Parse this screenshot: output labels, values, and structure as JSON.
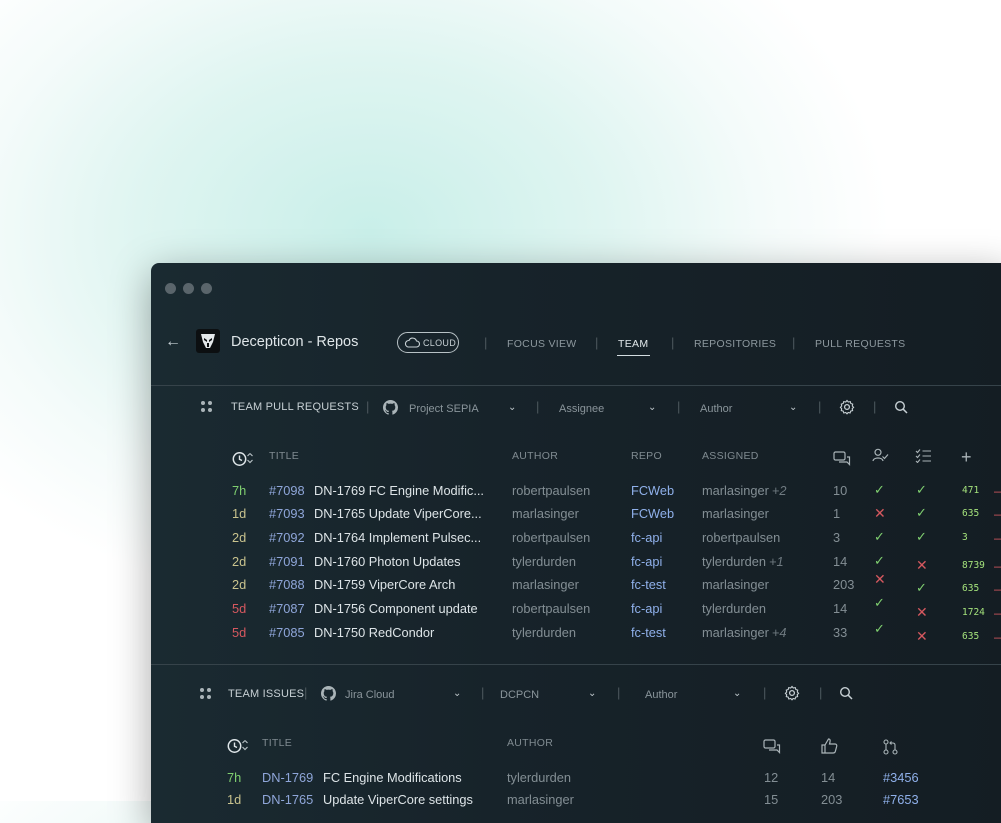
{
  "window": {
    "title": "Decepticon - Repos",
    "cloud_label": "CLOUD"
  },
  "nav": [
    {
      "label": "FOCUS VIEW"
    },
    {
      "label": "TEAM"
    },
    {
      "label": "REPOSITORIES"
    },
    {
      "label": "PULL REQUESTS"
    }
  ],
  "pr_section": {
    "title": "TEAM PULL REQUESTS",
    "filters": {
      "project": "Project SEPIA",
      "assignee": "Assignee",
      "author": "Author"
    },
    "columns": {
      "title": "TITLE",
      "author": "AUTHOR",
      "repo": "REPO",
      "assigned": "ASSIGNED"
    },
    "rows": [
      {
        "age": "7h",
        "number": "#7098",
        "title": "DN-1769 FC Engine Modific...",
        "author": "robertpaulsen",
        "repo": "FCWeb",
        "assigned": "marlasinger",
        "extra": "+2",
        "comments": "10",
        "approved": "✓",
        "checks": "✓",
        "metric": "471",
        "dash": "—"
      },
      {
        "age": "1d",
        "number": "#7093",
        "title": "DN-1765 Update ViperCore...",
        "author": "marlasinger",
        "repo": "FCWeb",
        "assigned": "marlasinger",
        "extra": "",
        "comments": "1",
        "approved": "✕",
        "checks": "✓",
        "metric": "635",
        "dash": "—"
      },
      {
        "age": "2d",
        "number": "#7092",
        "title": "DN-1764 Implement Pulsec...",
        "author": "robertpaulsen",
        "repo": "fc-api",
        "assigned": "robertpaulsen",
        "extra": "",
        "comments": "3",
        "approved": "✓",
        "checks": "✓",
        "metric": "3",
        "dash": "—"
      },
      {
        "age": "2d",
        "number": "#7091",
        "title": "DN-1760 Photon Updates",
        "author": "tylerdurden",
        "repo": "fc-api",
        "assigned": "tylerdurden",
        "extra": "+1",
        "comments": "14",
        "approved": "✓",
        "checks": "✕",
        "metric": "8739",
        "dash": "—"
      },
      {
        "age": "2d",
        "number": "#7088",
        "title": "DN-1759 ViperCore Arch",
        "author": "marlasinger",
        "repo": "fc-test",
        "assigned": "marlasinger",
        "extra": "",
        "comments": "203",
        "approved": "✕",
        "checks": "✓",
        "metric": "635",
        "dash": "—"
      },
      {
        "age": "5d",
        "number": "#7087",
        "title": "DN-1756 Component update",
        "author": "robertpaulsen",
        "repo": "fc-api",
        "assigned": "tylerdurden",
        "extra": "",
        "comments": "14",
        "approved": "✓",
        "checks": "✕",
        "metric": "1724",
        "dash": "—"
      },
      {
        "age": "5d",
        "number": "#7085",
        "title": "DN-1750 RedCondor",
        "author": "tylerdurden",
        "repo": "fc-test",
        "assigned": "marlasinger",
        "extra": "+4",
        "comments": "33",
        "approved": "✓",
        "checks": "✕",
        "metric": "635",
        "dash": "—"
      }
    ]
  },
  "issues_section": {
    "title": "TEAM ISSUES",
    "filters": {
      "source": "Jira Cloud",
      "project": "DCPCN",
      "author": "Author"
    },
    "columns": {
      "title": "TITLE",
      "author": "AUTHOR"
    },
    "rows": [
      {
        "age": "7h",
        "key": "DN-1769",
        "title": "FC Engine Modifications",
        "author": "tylerdurden",
        "comments": "12",
        "likes": "14",
        "pr": "#3456"
      },
      {
        "age": "1d",
        "key": "DN-1765",
        "title": "Update ViperCore settings",
        "author": "marlasinger",
        "comments": "15",
        "likes": "203",
        "pr": "#7653"
      }
    ]
  },
  "colors": {
    "accent_green": "#7fcf70",
    "accent_red": "#d5585f",
    "link_blue": "#8fb0ea",
    "background": "#17232a"
  }
}
